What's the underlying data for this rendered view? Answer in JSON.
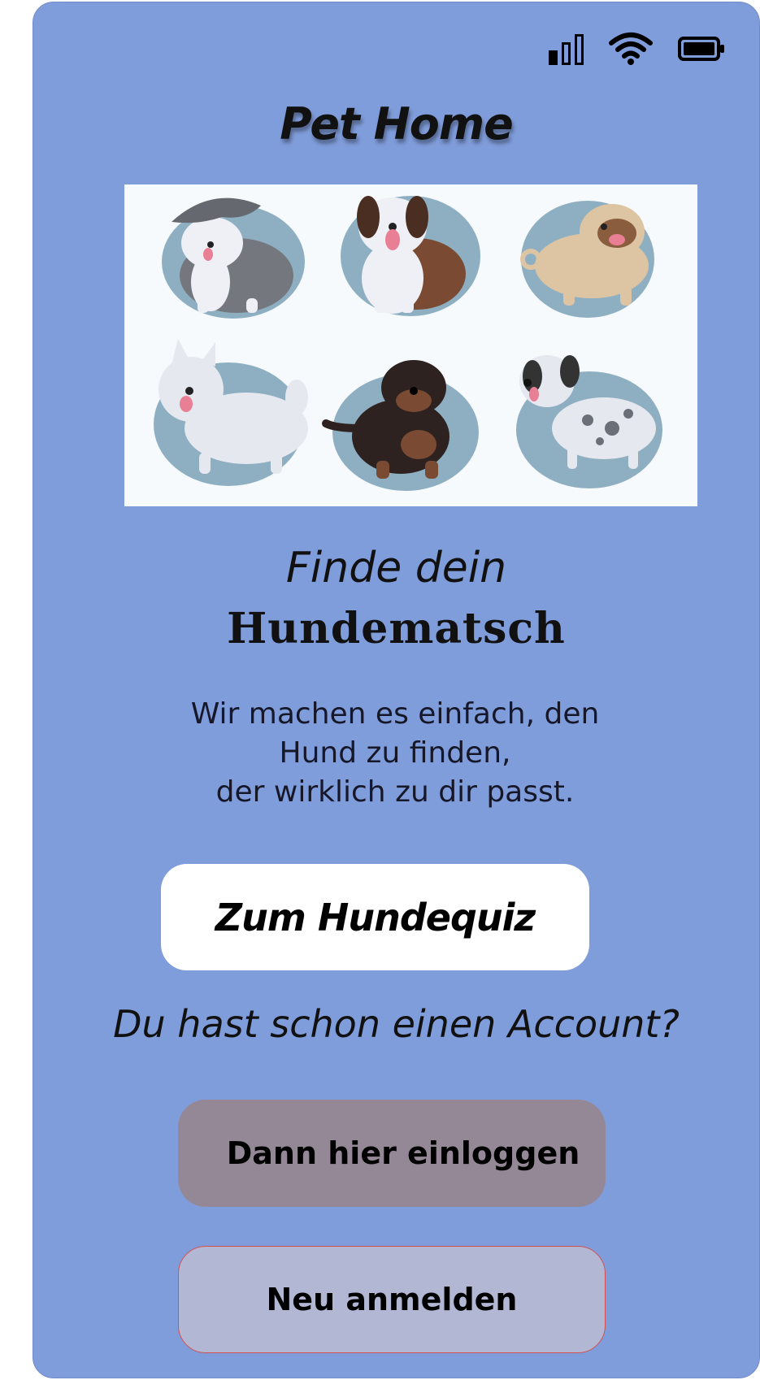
{
  "status_bar": {
    "icons": [
      "signal-icon",
      "wifi-icon",
      "battery-icon"
    ]
  },
  "app": {
    "title": "Pet Home"
  },
  "hero": {
    "image_alt_icons": [
      "sheepdog-icon",
      "saint-bernard-icon",
      "pug-icon",
      "samoyed-icon",
      "rottweiler-icon",
      "dalmatian-icon"
    ]
  },
  "headline": {
    "line1": "Finde dein",
    "line2": "Hundematsch"
  },
  "subtitle": {
    "line1": "Wir machen es einfach, den",
    "line2": "Hund zu finden,",
    "line3": "der wirklich zu dir passt."
  },
  "buttons": {
    "quiz": "Zum Hundequiz",
    "login": "Dann hier einloggen",
    "register": "Neu anmelden"
  },
  "account_question": "Du hast schon einen Account?",
  "colors": {
    "background": "#809ddb",
    "quiz_button": "#ffffff",
    "login_button": "#948896",
    "register_button": "#b2b7d4",
    "register_border": "#d45050"
  }
}
